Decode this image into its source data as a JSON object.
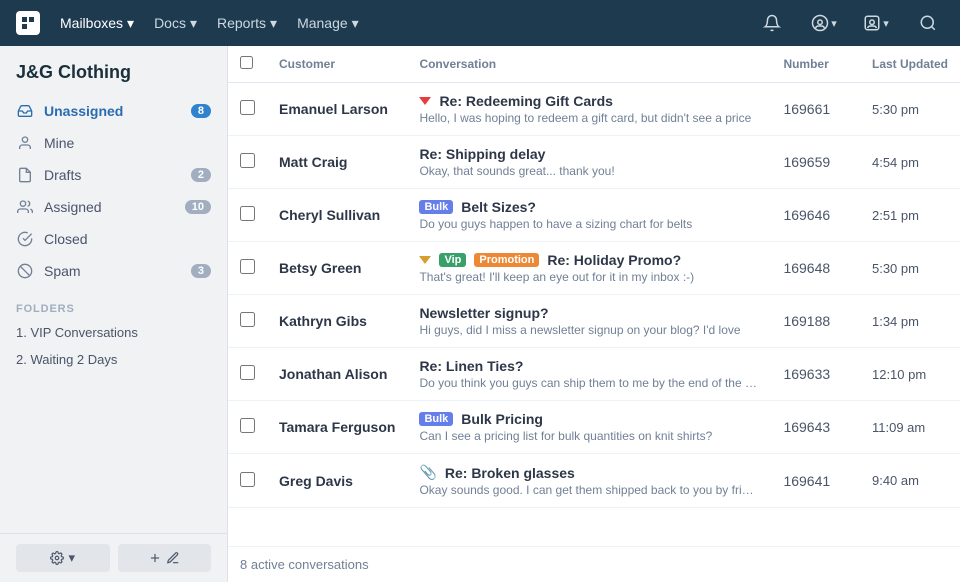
{
  "topnav": {
    "logo_label": "HelpScout",
    "items": [
      {
        "label": "Mailboxes",
        "has_arrow": true,
        "active": true
      },
      {
        "label": "Docs",
        "has_arrow": true
      },
      {
        "label": "Reports",
        "has_arrow": true
      },
      {
        "label": "Manage",
        "has_arrow": true
      }
    ],
    "icons": [
      "bell",
      "user-circle",
      "avatar",
      "search"
    ]
  },
  "sidebar": {
    "company": "J&G Clothing",
    "nav_items": [
      {
        "id": "unassigned",
        "label": "Unassigned",
        "icon": "inbox",
        "badge": "8",
        "active": true
      },
      {
        "id": "mine",
        "label": "Mine",
        "icon": "user",
        "badge": null
      },
      {
        "id": "drafts",
        "label": "Drafts",
        "icon": "file",
        "badge": "2"
      },
      {
        "id": "assigned",
        "label": "Assigned",
        "icon": "users",
        "badge": "10"
      },
      {
        "id": "closed",
        "label": "Closed",
        "icon": "check-circle",
        "badge": null
      },
      {
        "id": "spam",
        "label": "Spam",
        "icon": "ban",
        "badge": "3"
      }
    ],
    "folders_label": "FOLDERS",
    "folders": [
      {
        "label": "1. VIP Conversations"
      },
      {
        "label": "2. Waiting 2 Days"
      }
    ],
    "bottom_buttons": [
      {
        "label": "⚙ ▾",
        "name": "settings-button"
      },
      {
        "label": "+ ✎",
        "name": "compose-button"
      }
    ]
  },
  "table": {
    "columns": [
      "",
      "Customer",
      "Conversation",
      "Number",
      "Last Updated"
    ],
    "rows": [
      {
        "flag": "red",
        "customer": "Emanuel Larson",
        "subject": "Re: Redeeming Gift Cards",
        "preview": "Hello, I was hoping to redeem a gift card, but didn't see a price",
        "tags": [],
        "attachment": false,
        "number": "169661",
        "updated": "5:30 pm"
      },
      {
        "flag": null,
        "customer": "Matt Craig",
        "subject": "Re: Shipping delay",
        "preview": "Okay, that sounds great... thank you!",
        "tags": [],
        "attachment": false,
        "number": "169659",
        "updated": "4:54 pm"
      },
      {
        "flag": null,
        "customer": "Cheryl Sullivan",
        "subject": "Belt Sizes?",
        "preview": "Do you guys happen to have a sizing chart for belts",
        "tags": [
          "Bulk"
        ],
        "attachment": false,
        "number": "169646",
        "updated": "2:51 pm"
      },
      {
        "flag": "yellow",
        "customer": "Betsy Green",
        "subject": "Re: Holiday Promo?",
        "preview": "That's great! I'll keep an eye out for it in my inbox :-)",
        "tags": [
          "Vip",
          "Promotion"
        ],
        "attachment": false,
        "number": "169648",
        "updated": "5:30 pm"
      },
      {
        "flag": null,
        "customer": "Kathryn Gibs",
        "subject": "Newsletter signup?",
        "preview": "Hi guys, did I miss a newsletter signup on your blog? I'd love",
        "tags": [],
        "attachment": false,
        "number": "169188",
        "updated": "1:34 pm"
      },
      {
        "flag": null,
        "customer": "Jonathan Alison",
        "subject": "Re: Linen Ties?",
        "preview": "Do you think you guys can ship them to me by the end of the wee",
        "tags": [],
        "attachment": false,
        "number": "169633",
        "updated": "12:10 pm"
      },
      {
        "flag": null,
        "customer": "Tamara Ferguson",
        "subject": "Bulk Pricing",
        "preview": "Can I see a pricing list for bulk quantities on knit shirts?",
        "tags": [
          "Bulk"
        ],
        "attachment": false,
        "number": "169643",
        "updated": "11:09 am"
      },
      {
        "flag": null,
        "customer": "Greg Davis",
        "subject": "Re: Broken glasses",
        "preview": "Okay sounds good. I can get them shipped back to you by friday",
        "tags": [],
        "attachment": true,
        "number": "169641",
        "updated": "9:40 am"
      }
    ],
    "footer": "8 active conversations"
  }
}
